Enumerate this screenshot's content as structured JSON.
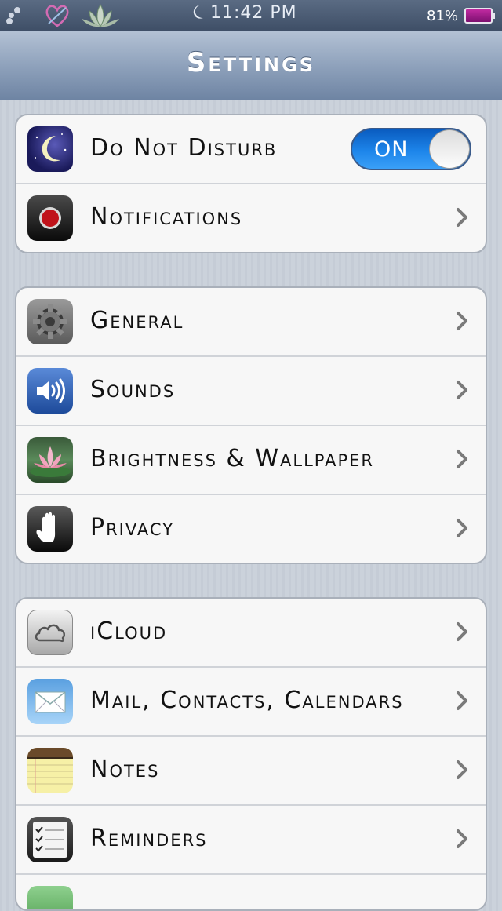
{
  "status_bar": {
    "time": "11:42 PM",
    "battery_percent": "81%",
    "battery_level": 0.81,
    "icons": [
      "dots-icon",
      "heart-icon",
      "lotus-icon",
      "moon-icon",
      "battery-icon"
    ]
  },
  "nav": {
    "title": "Settings"
  },
  "groups": [
    {
      "rows": [
        {
          "label": "Do Not Disturb",
          "icon": "moon-icon",
          "control": "toggle",
          "toggle_label": "ON",
          "toggle_on": true
        },
        {
          "label": "Notifications",
          "icon": "notifications-icon",
          "control": "chevron"
        }
      ]
    },
    {
      "rows": [
        {
          "label": "General",
          "icon": "gear-icon",
          "control": "chevron"
        },
        {
          "label": "Sounds",
          "icon": "speaker-icon",
          "control": "chevron"
        },
        {
          "label": "Brightness & Wallpaper",
          "icon": "lotus-flower-icon",
          "control": "chevron"
        },
        {
          "label": "Privacy",
          "icon": "hand-icon",
          "control": "chevron"
        }
      ]
    },
    {
      "rows": [
        {
          "label": "iCloud",
          "icon": "cloud-icon",
          "control": "chevron"
        },
        {
          "label": "Mail, Contacts, Calendars",
          "icon": "envelope-icon",
          "control": "chevron"
        },
        {
          "label": "Notes",
          "icon": "notepad-icon",
          "control": "chevron"
        },
        {
          "label": "Reminders",
          "icon": "checklist-icon",
          "control": "chevron"
        }
      ]
    }
  ],
  "colors": {
    "toggle_on": "#1d85ea",
    "nav_bar": "#8fa2bc",
    "background": "#c8cfd8"
  }
}
